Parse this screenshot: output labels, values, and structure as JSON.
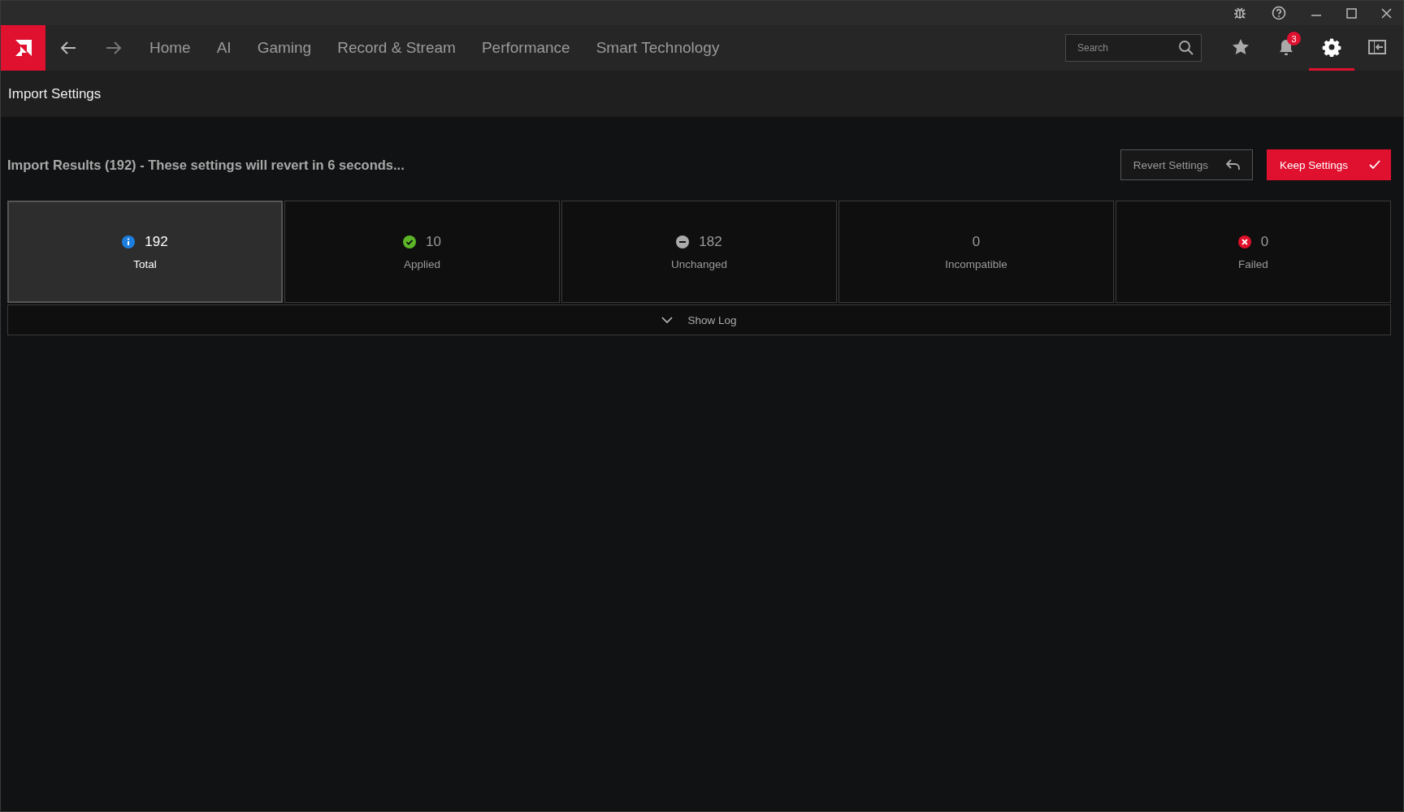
{
  "nav": {
    "items": [
      {
        "label": "Home"
      },
      {
        "label": "AI"
      },
      {
        "label": "Gaming"
      },
      {
        "label": "Record & Stream"
      },
      {
        "label": "Performance"
      },
      {
        "label": "Smart Technology"
      }
    ],
    "search": {
      "placeholder": "Search"
    },
    "tools": [
      {
        "kind": "star",
        "selected": false
      },
      {
        "kind": "bell",
        "selected": false,
        "badge": "3"
      },
      {
        "kind": "gear",
        "selected": true
      },
      {
        "kind": "panel",
        "selected": false
      }
    ]
  },
  "page_title": "Import Settings",
  "results": {
    "heading": "Import Results (192) - These settings will revert in 6 seconds...",
    "buttons": [
      {
        "kind": "revert",
        "label": "Revert Settings"
      },
      {
        "kind": "keep",
        "label": "Keep Settings"
      }
    ],
    "stats": [
      {
        "kind": "info",
        "value": "192",
        "label": "Total",
        "selected": true
      },
      {
        "kind": "success",
        "value": "10",
        "label": "Applied",
        "selected": false
      },
      {
        "kind": "neutral",
        "value": "182",
        "label": "Unchanged",
        "selected": false
      },
      {
        "kind": "none",
        "value": "0",
        "label": "Incompatible",
        "selected": false
      },
      {
        "kind": "error",
        "value": "0",
        "label": "Failed",
        "selected": false
      }
    ],
    "show_log": {
      "label": "Show Log",
      "expanded": false
    }
  }
}
